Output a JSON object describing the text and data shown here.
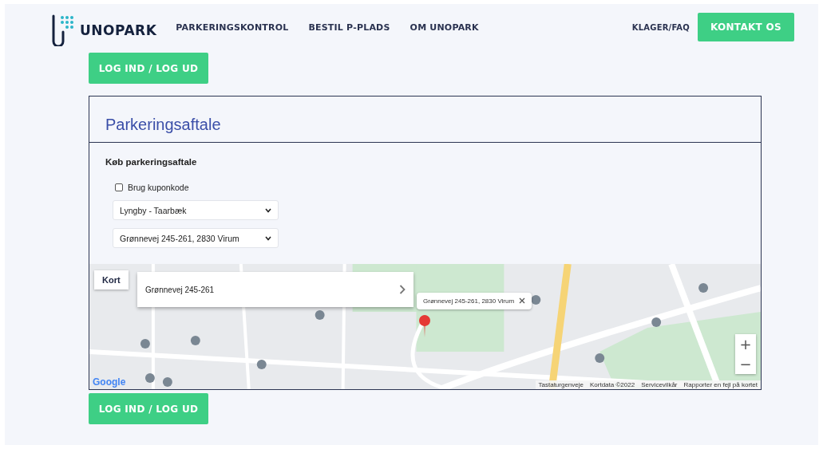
{
  "header": {
    "logo": "UNOPARK",
    "nav": [
      {
        "label": "PARKERINGSKONTROL"
      },
      {
        "label": "BESTIL P-PLADS"
      },
      {
        "label": "OM UNOPARK"
      }
    ],
    "faq_link": "KLAGER/FAQ",
    "contact_button": "KONTAKT OS"
  },
  "login_button_top": "LOG IND / LOG UD",
  "card": {
    "title": "Parkeringsaftale",
    "subtitle": "Køb parkeringsaftale",
    "coupon": {
      "label": "Brug kuponkode",
      "checked": false
    },
    "selects": [
      {
        "value": "Lyngby - Taarbæk"
      },
      {
        "value": "Grønnevej 245-261, 2830 Virum"
      }
    ],
    "map": {
      "type_button": "Kort",
      "place_card": "Grønnevej 245-261",
      "info_window": "Grønnevej 245-261, 2830 Virum",
      "zoom_in": "+",
      "zoom_out": "−",
      "logo": "Google",
      "footer": [
        "Tastaturgenveje",
        "Kortdata ©2022",
        "Servicevilkår",
        "Rapporter en fejl på kortet"
      ]
    }
  },
  "login_button_bottom": "LOG IND / LOG UD"
}
